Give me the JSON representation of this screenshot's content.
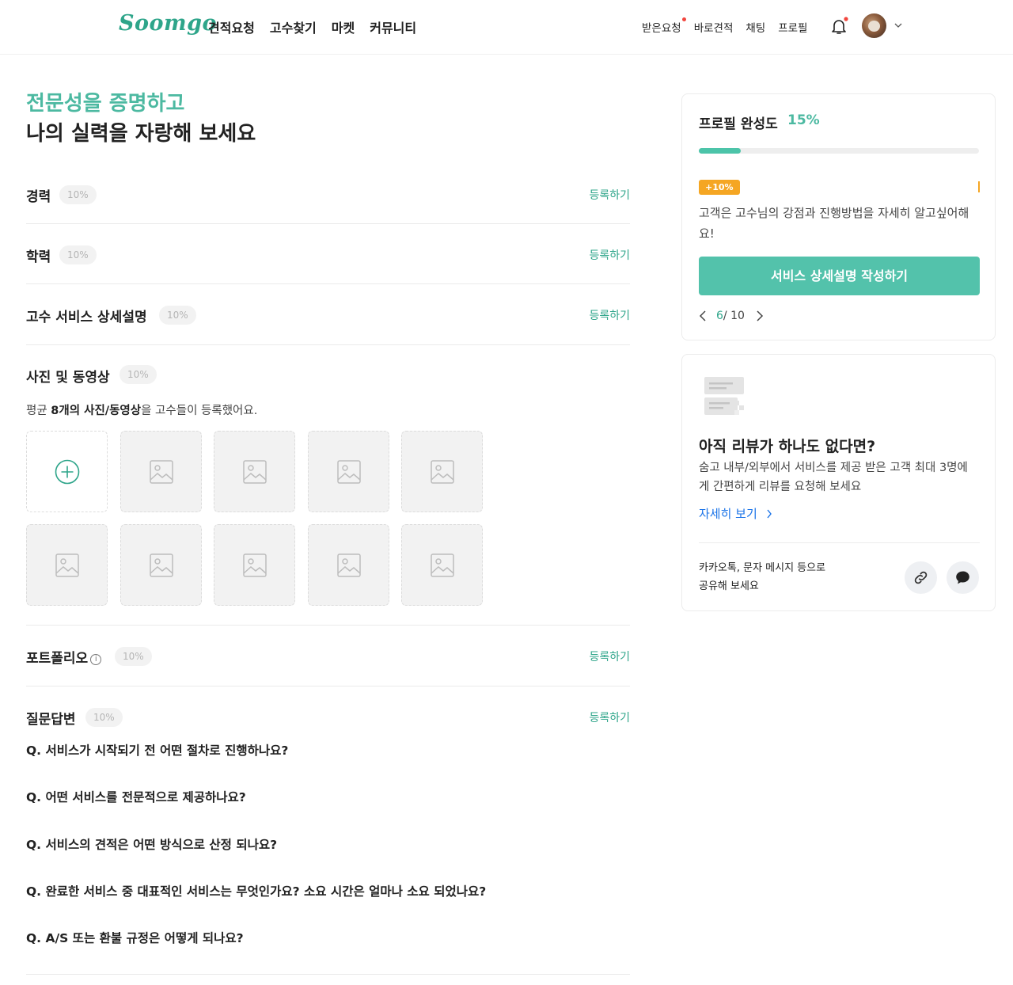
{
  "header": {
    "logo": "Soomgo",
    "nav": [
      "견적요청",
      "고수찾기",
      "마켓",
      "커뮤니티"
    ],
    "right_menu": [
      "받은요청",
      "바로견적",
      "채팅",
      "프로필"
    ]
  },
  "headline": {
    "line1": "전문성을 증명하고",
    "line2": "나의 실력을 자랑해 보세요"
  },
  "sections": {
    "career": {
      "title": "경력",
      "badge": "10%",
      "action": "등록하기"
    },
    "education": {
      "title": "학력",
      "badge": "10%",
      "action": "등록하기"
    },
    "service_detail": {
      "title": "고수 서비스 상세설명",
      "badge": "10%",
      "action": "등록하기"
    },
    "media": {
      "title": "사진 및 동영상",
      "badge": "10%",
      "desc_prefix": "평균 ",
      "desc_bold": "8개의 사진/동영상",
      "desc_suffix": "을 고수들이 등록했어요."
    },
    "portfolio": {
      "title": "포트폴리오",
      "info": "i",
      "badge": "10%",
      "action": "등록하기"
    },
    "qna": {
      "title": "질문답변",
      "badge": "10%",
      "action": "등록하기",
      "questions": [
        "Q. 서비스가 시작되기 전 어떤 절차로 진행하나요?",
        "Q. 어떤 서비스를 전문적으로 제공하나요?",
        "Q. 서비스의 견적은 어떤 방식으로 산정 되나요?",
        "Q. 완료한 서비스 중 대표적인 서비스는 무엇인가요? 소요 시간은 얼마나 소요 되었나요?",
        "Q. A/S 또는 환불 규정은 어떻게 되나요?"
      ]
    }
  },
  "profile_card": {
    "title": "프로필 완성도",
    "percent": "15%",
    "progress": 0.15,
    "tag": "+10%",
    "tip": "고객은 고수님의 강점과 진행방법을 자세히 알고싶어해요!",
    "cta": "서비스 상세설명 작성하기",
    "page_current": "6",
    "page_total": "/ 10"
  },
  "review_card": {
    "title": "아직 리뷰가 하나도 없다면?",
    "desc": "숨고 내부/외부에서 서비스를 제공 받은 고객 최대 3명에게 간편하게 리뷰를 요청해 보세요",
    "link": "자세히 보기",
    "share_line1": "카카오톡, 문자 메시지 등으로",
    "share_line2": "공유해 보세요"
  },
  "colors": {
    "brand": "#2ea58a",
    "accent": "#4cb9a1",
    "cta": "#53c2ab",
    "tag": "#f5a623",
    "link": "#1a73e8",
    "notification_dot": "#f2453d"
  },
  "icons": [
    "bell-icon",
    "chevron-down-icon",
    "plus-circle-icon",
    "image-placeholder-icon",
    "info-icon",
    "chevron-left-icon",
    "chevron-right-icon",
    "document-icon",
    "link-icon",
    "chat-bubble-icon"
  ]
}
